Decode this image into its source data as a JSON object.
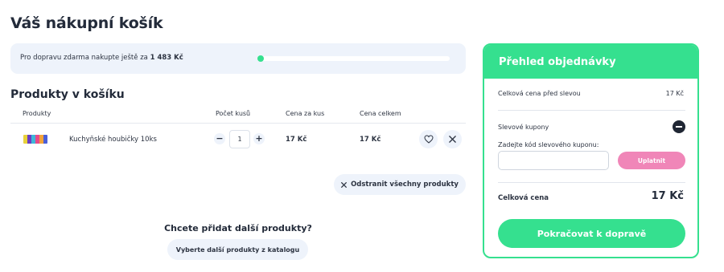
{
  "page": {
    "title": "Váš nákupní košík"
  },
  "shipping": {
    "text_before": "Pro dopravu zdarma nakupte ještě za",
    "remaining": "1 483 Kč",
    "progress_fraction": 0.01
  },
  "cart": {
    "section_title": "Produkty v košíku",
    "columns": {
      "products": "Produkty",
      "quantity": "Počet kusů",
      "unit_price": "Cena za kus",
      "total_price": "Cena celkem"
    },
    "items": [
      {
        "name": "Kuchyňské houbičky 10ks",
        "quantity": "1",
        "unit_price": "17 Kč",
        "total_price": "17 Kč",
        "thumb_colors": [
          "#e8d13a",
          "#6a3fc4",
          "#3fb6d8",
          "#e84a8a",
          "#f2a23a",
          "#4a5fd8"
        ]
      }
    ],
    "remove_all_label": "Odstranit všechny produkty"
  },
  "more": {
    "question": "Chcete přidat další produkty?",
    "catalog_button": "Vyberte další produkty z katalogu"
  },
  "summary": {
    "title": "Přehled objednávky",
    "before_discount_label": "Celková cena před slevou",
    "before_discount_value": "17 Kč",
    "coupons_label": "Slevové kupony",
    "coupon_prompt": "Zadejte kód slevového kuponu:",
    "coupon_value": "",
    "apply_label": "Uplatnit",
    "total_label": "Celková cena",
    "total_value": "17 Kč",
    "continue_label": "Pokračovat k dopravě"
  },
  "colors": {
    "accent_green": "#35e08f",
    "accent_pink": "#f086b8",
    "soft_bg": "#eef3fb"
  }
}
